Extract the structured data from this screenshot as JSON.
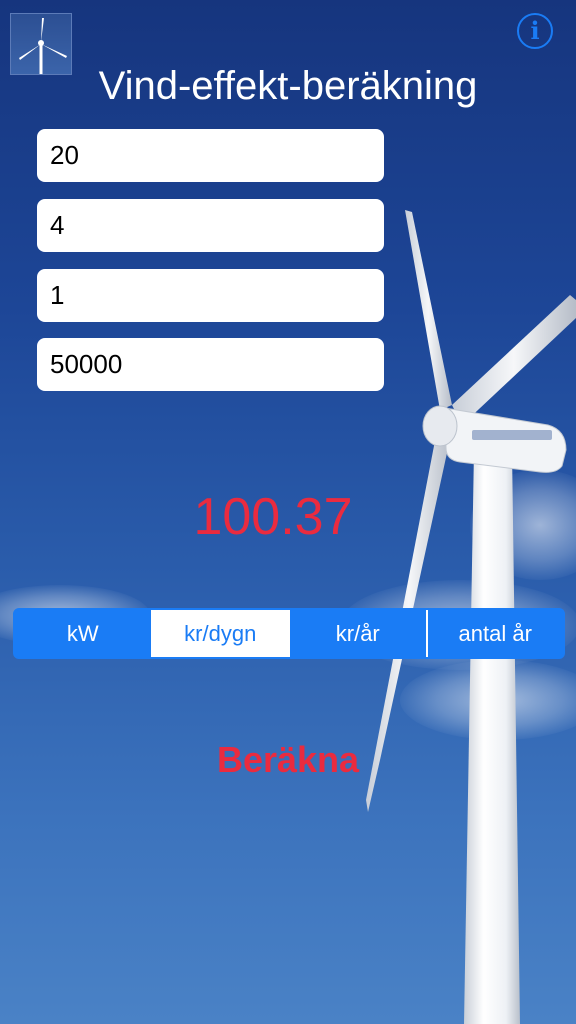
{
  "app": {
    "title": "Vind-effekt-beräkning",
    "icon": "wind-turbine-icon",
    "info_icon": "info-icon",
    "info_glyph": "i"
  },
  "inputs": [
    {
      "value": "20"
    },
    {
      "value": "4"
    },
    {
      "value": "1"
    },
    {
      "value": "50000"
    }
  ],
  "result": {
    "value": "100.37",
    "color": "#ea2b3f"
  },
  "segments": {
    "selected": "kr/dygn",
    "items": [
      {
        "label": "kW"
      },
      {
        "label": "kr/dygn"
      },
      {
        "label": "kr/år"
      },
      {
        "label": "antal år"
      }
    ],
    "accent_color": "#1a7cf5"
  },
  "calculate": {
    "label": "Beräkna",
    "color": "#ea2b3f"
  }
}
